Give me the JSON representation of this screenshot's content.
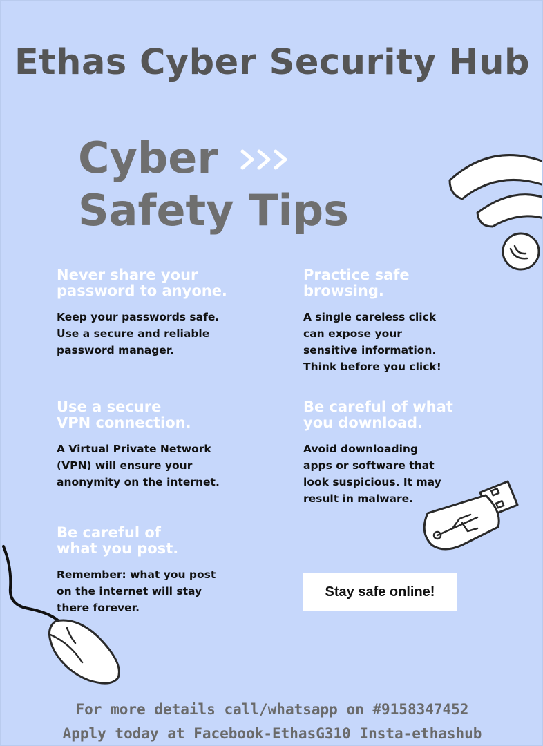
{
  "header": {
    "hub_title": "Ethas Cyber Security Hub"
  },
  "heading": {
    "line1": "Cyber",
    "line2": "Safety Tips",
    "arrow_icon": "triple-chevron-right-icon"
  },
  "tips": [
    {
      "title": "Never share your\npassword to anyone.",
      "body": "Keep your passwords safe.\nUse a secure and reliable\npassword manager."
    },
    {
      "title": "Practice safe\nbrowsing.",
      "body": "A single careless click\ncan expose your\nsensitive information.\nThink before you click!"
    },
    {
      "title": "Use a secure\nVPN connection.",
      "body": "A Virtual Private Network\n(VPN) will ensure your\nanonymity on the internet."
    },
    {
      "title": "Be careful of what\nyou download.",
      "body": "Avoid downloading\napps or software that\nlook suspicious. It may\nresult in malware."
    },
    {
      "title": "Be careful of\nwhat you post.",
      "body": "Remember: what you post\non the internet will stay\nthere forever."
    }
  ],
  "cta": {
    "label": "Stay safe online!"
  },
  "footer": {
    "line1": "For more details call/whatsapp on #9158347452",
    "line2": "Apply today at Facebook-EthasG310 Insta-ethashub"
  },
  "icons": [
    "wifi-icon",
    "usb-drive-icon",
    "computer-mouse-icon"
  ],
  "colors": {
    "background": "#c6d7fb",
    "title_text": "#555555",
    "tip_title": "#ffffff",
    "body_text": "#111111"
  }
}
